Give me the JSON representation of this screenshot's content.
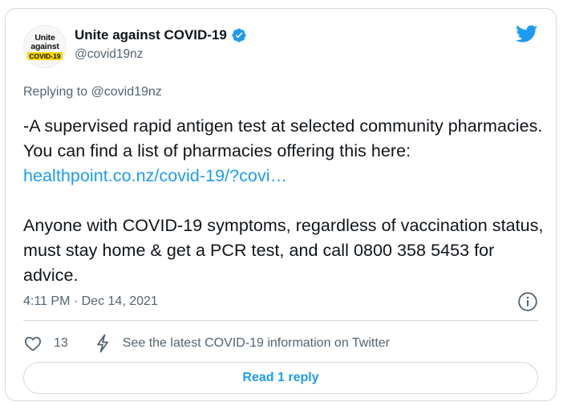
{
  "author": {
    "name": "Unite against COVID-19",
    "handle": "@covid19nz",
    "avatar_line1": "Unite",
    "avatar_line2": "against",
    "avatar_line3": "COVID-19",
    "verified": true
  },
  "replying_to": "Replying to @covid19nz",
  "tweet": {
    "text_before_link": "-A supervised rapid antigen test at selected community pharmacies. You can find a list of pharmacies offering this here: ",
    "link": "healthpoint.co.nz/covid-19/?covi…",
    "text_after_link": "\n\nAnyone with COVID-19 symptoms, regardless of vaccination status, must stay home & get a PCR test, and call 0800 358 5453 for advice."
  },
  "timestamp": "4:11 PM · Dec 14, 2021",
  "actions": {
    "like_count": "13",
    "info_link": "See the latest COVID-19 information on Twitter"
  },
  "reply_button": "Read 1 reply",
  "colors": {
    "accent": "#1d9bf0",
    "muted": "#536471",
    "text": "#0f1419",
    "border": "#cfd9de",
    "brand_yellow": "#f5d800"
  },
  "icons": {
    "verified": "verified-badge-icon",
    "logo": "twitter-bird-icon",
    "info": "info-icon",
    "like": "heart-icon",
    "covid_info": "lightning-bolt-icon"
  }
}
